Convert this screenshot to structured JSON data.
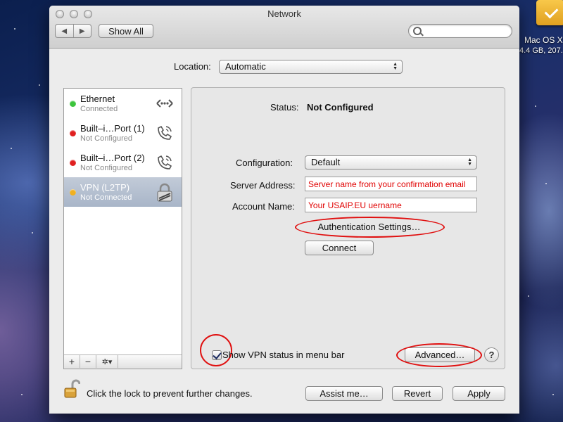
{
  "desktop": {
    "disk_name": "Mac OS X",
    "disk_info": "4.4 GB, 207.",
    "disk_icon": "external-disk-icon"
  },
  "window": {
    "title": "Network",
    "toolbar": {
      "back_glyph": "◀",
      "forward_glyph": "▶",
      "show_all_label": "Show All",
      "search_placeholder": "",
      "search_icon": "magnifier-icon"
    },
    "location": {
      "label": "Location:",
      "value": "Automatic"
    },
    "services": [
      {
        "name": "Ethernet",
        "status": "Connected",
        "dot_color": "#3cc43c",
        "icon": "ethernet-icon",
        "selected": false
      },
      {
        "name": "Built–i…Port (1)",
        "status": "Not Configured",
        "dot_color": "#e02020",
        "icon": "phone-modem-icon",
        "selected": false
      },
      {
        "name": "Built–i…Port (2)",
        "status": "Not Configured",
        "dot_color": "#e02020",
        "icon": "phone-modem-icon",
        "selected": false
      },
      {
        "name": "VPN (L2TP)",
        "status": "Not Connected",
        "dot_color": "#f0b020",
        "icon": "vpn-lock-icon",
        "selected": true
      }
    ],
    "sidebar_buttons": {
      "add": "+",
      "remove": "−",
      "action": "✲▾"
    },
    "detail": {
      "status_label": "Status:",
      "status_value": "Not Configured",
      "configuration_label": "Configuration:",
      "configuration_value": "Default",
      "server_label": "Server Address:",
      "server_value": "Server name from your confirmation email",
      "account_label": "Account Name:",
      "account_value": "Your USAIP.EU uername",
      "auth_button": "Authentication Settings…",
      "connect_button": "Connect",
      "show_status_label": "Show VPN status in menu bar",
      "show_status_checked": true,
      "advanced_button": "Advanced…",
      "help_button": "?",
      "annotation_color": "#e01010"
    },
    "footer": {
      "lock_text": "Click the lock to prevent further changes.",
      "assist_button": "Assist me…",
      "revert_button": "Revert",
      "apply_button": "Apply"
    }
  }
}
